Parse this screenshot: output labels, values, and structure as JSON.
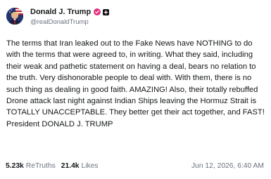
{
  "author": {
    "display_name": "Donald J. Trump",
    "handle": "@realDonaldTrump",
    "avatar_icon": "avatar-portrait-flag",
    "verified_icon": "verified-badge-icon",
    "affiliation_icon": "square-affiliation-icon",
    "badge_color": "#e0307e"
  },
  "post": {
    "text": "The terms that Iran leaked out to the Fake News have NOTHING to do with the terms that were agreed to, in writing. What they said, including their weak and pathetic statement on having a deal, bears no relation to the truth. Very dishonorable people to deal with. With them, there is no such thing as dealing in good faith. AMAZING! Also, their totally rebuffed Drone attack last night against Indian Ships leaving the Hormuz Strait is TOTALLY UNACCEPTABLE. They better get their act together, and FAST! President DONALD J. TRUMP"
  },
  "stats": {
    "retruths_count": "5.23k",
    "retruths_label": "ReTruths",
    "likes_count": "21.4k",
    "likes_label": "Likes",
    "timestamp": "Jun 12, 2026, 6:40 AM"
  }
}
